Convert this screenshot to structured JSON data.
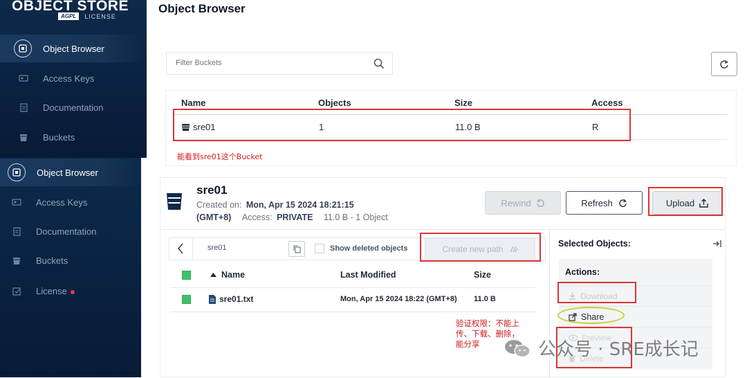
{
  "brand": {
    "line1": "OBJECT STORE",
    "badge": "AGPL",
    "license": "LICENSE"
  },
  "sidebar_top": [
    {
      "label": "Object Browser",
      "icon": "object-browser-icon",
      "active": true
    },
    {
      "label": "Access Keys",
      "icon": "access-keys-icon"
    },
    {
      "label": "Documentation",
      "icon": "documentation-icon"
    },
    {
      "label": "Buckets",
      "icon": "bucket-icon"
    }
  ],
  "sidebar_bottom": [
    {
      "label": "Object Browser",
      "icon": "object-browser-icon",
      "active": true
    },
    {
      "label": "Access Keys",
      "icon": "access-keys-icon"
    },
    {
      "label": "Documentation",
      "icon": "documentation-icon"
    },
    {
      "label": "Buckets",
      "icon": "bucket-icon"
    },
    {
      "label": "License",
      "icon": "license-icon"
    }
  ],
  "page_title": "Object Browser",
  "filter": {
    "placeholder": "Filter Buckets"
  },
  "buckets_table": {
    "headers": [
      "Name",
      "Objects",
      "Size",
      "Access"
    ],
    "rows": [
      {
        "name": "sre01",
        "objects": "1",
        "size": "11.0 B",
        "access": "R"
      }
    ]
  },
  "annotation_top": "能看到sre01这个Bucket",
  "bucket": {
    "name": "sre01",
    "created_label": "Created on:",
    "created_value": "Mon, Apr 15 2024 18:21:15",
    "tz": "(GMT+8)",
    "access_label": "Access:",
    "access_value": "PRIVATE",
    "summary": "11.0 B - 1 Object"
  },
  "buttons": {
    "rewind": "Rewind",
    "refresh": "Refresh",
    "upload": "Upload"
  },
  "browser": {
    "path": "sre01",
    "show_deleted": "Show deleted objects",
    "create_path": "Create new path",
    "headers": {
      "name": "Name",
      "modified": "Last Modified",
      "size": "Size"
    },
    "rows": [
      {
        "name": "sre01.txt",
        "modified": "Mon, Apr 15 2024 18:22 (GMT+8)",
        "size": "11.0 B"
      }
    ]
  },
  "selected": {
    "title": "Selected Objects:",
    "actions_title": "Actions:",
    "actions": [
      "Download",
      "Share",
      "Preview",
      "Delete"
    ]
  },
  "annotation_bottom": [
    "验证权限：不能上",
    "传、下载、删除，",
    "能分享"
  ],
  "watermark": "公众号 · SRE成长记",
  "colors": {
    "sidebar_bg": "#0a2140",
    "annotation_red": "#d93636",
    "share_highlight": "#c9cc3a",
    "check_green": "#3dc26a"
  }
}
